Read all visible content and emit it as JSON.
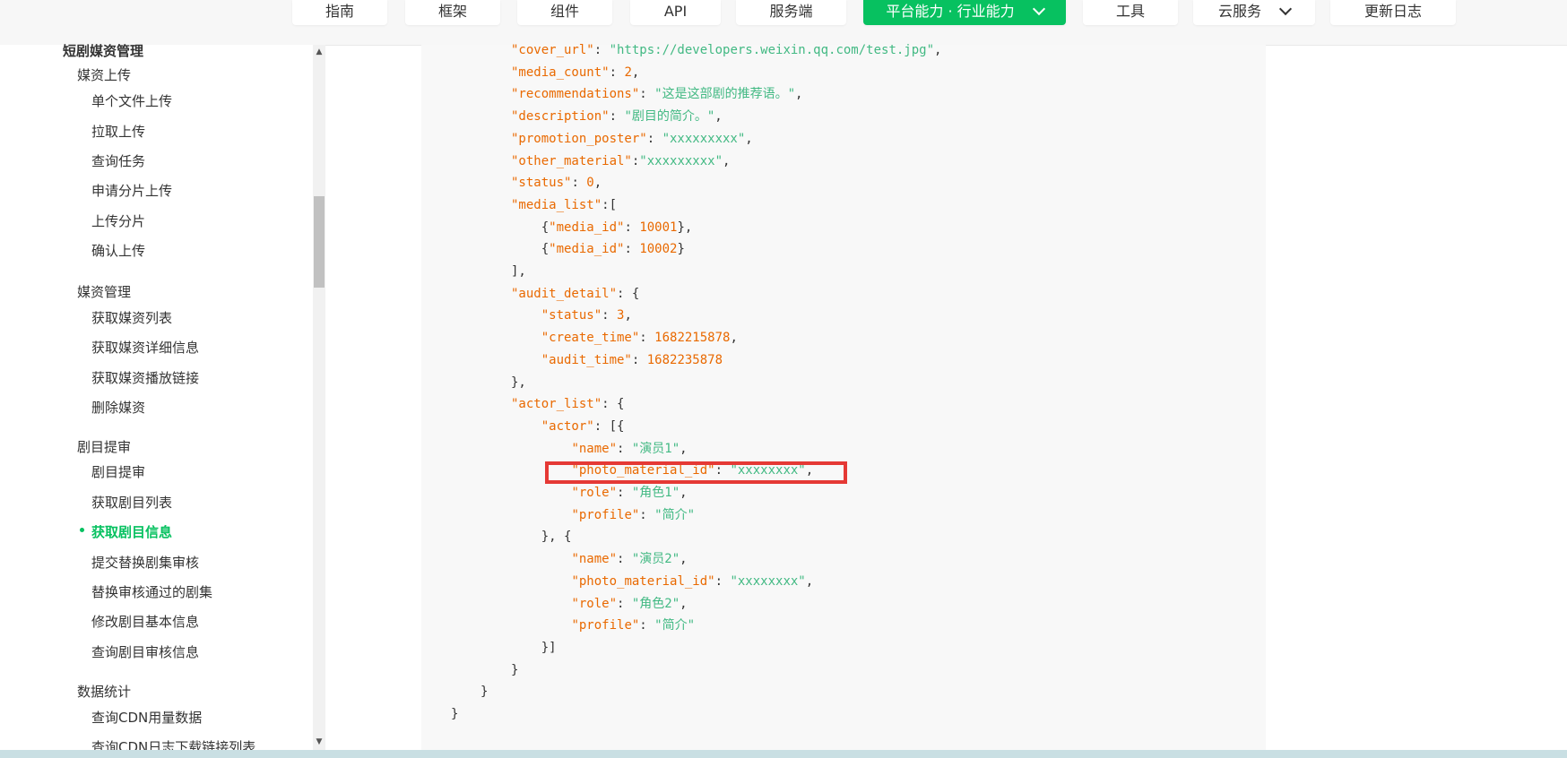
{
  "topnav": {
    "items": [
      {
        "label": "指南",
        "active": false
      },
      {
        "label": "框架",
        "active": false
      },
      {
        "label": "组件",
        "active": false
      },
      {
        "label": "API",
        "active": false
      },
      {
        "label": "服务端",
        "active": false
      },
      {
        "label": "平台能力 · 行业能力",
        "active": true,
        "dropdown": true
      },
      {
        "label": "工具",
        "active": false
      },
      {
        "label": "云服务",
        "active": false,
        "dropdown": true
      },
      {
        "label": "更新日志",
        "active": false
      }
    ],
    "accent_color": "#07c160"
  },
  "sidebar": {
    "top_section": "短剧媒资管理",
    "sections": [
      {
        "title": "媒资上传",
        "items": [
          "单个文件上传",
          "拉取上传",
          "查询任务",
          "申请分片上传",
          "上传分片",
          "确认上传"
        ]
      },
      {
        "title": "媒资管理",
        "items": [
          "获取媒资列表",
          "获取媒资详细信息",
          "获取媒资播放链接",
          "删除媒资"
        ]
      },
      {
        "title": "剧目提审",
        "items": [
          "剧目提审",
          "获取剧目列表",
          "获取剧目信息",
          "提交替换剧集审核",
          "替换审核通过的剧集",
          "修改剧目基本信息",
          "查询剧目审核信息"
        ],
        "active_item": "获取剧目信息"
      },
      {
        "title": "数据统计",
        "items": [
          "查询CDN用量数据",
          "查询CDN日志下载链接列表"
        ]
      }
    ]
  },
  "code": {
    "lines": [
      [
        {
          "t": "\"cover_url\"",
          "c": "k"
        },
        {
          "t": ": ",
          "c": "p"
        },
        {
          "t": "\"https://developers.weixin.qq.com/test.jpg\"",
          "c": "s"
        },
        {
          "t": ",",
          "c": "p"
        }
      ],
      [
        {
          "t": "\"media_count\"",
          "c": "k"
        },
        {
          "t": ": ",
          "c": "p"
        },
        {
          "t": "2",
          "c": "n"
        },
        {
          "t": ",",
          "c": "p"
        }
      ],
      [
        {
          "t": "\"recommendations\"",
          "c": "k"
        },
        {
          "t": ": ",
          "c": "p"
        },
        {
          "t": "\"这是这部剧的推荐语。\"",
          "c": "s"
        },
        {
          "t": ",",
          "c": "p"
        }
      ],
      [
        {
          "t": "\"description\"",
          "c": "k"
        },
        {
          "t": ": ",
          "c": "p"
        },
        {
          "t": "\"剧目的简介。\"",
          "c": "s"
        },
        {
          "t": ",",
          "c": "p"
        }
      ],
      [
        {
          "t": "\"promotion_poster\"",
          "c": "k"
        },
        {
          "t": ": ",
          "c": "p"
        },
        {
          "t": "\"xxxxxxxxx\"",
          "c": "s"
        },
        {
          "t": ",",
          "c": "p"
        }
      ],
      [
        {
          "t": "\"other_material\"",
          "c": "k"
        },
        {
          "t": ":",
          "c": "p"
        },
        {
          "t": "\"xxxxxxxxx\"",
          "c": "s"
        },
        {
          "t": ",",
          "c": "p"
        }
      ],
      [
        {
          "t": "\"status\"",
          "c": "k"
        },
        {
          "t": ": ",
          "c": "p"
        },
        {
          "t": "0",
          "c": "n"
        },
        {
          "t": ",",
          "c": "p"
        }
      ],
      [
        {
          "t": "\"media_list\"",
          "c": "k"
        },
        {
          "t": ":[",
          "c": "p"
        }
      ],
      [
        {
          "t": "    {",
          "c": "p"
        },
        {
          "t": "\"media_id\"",
          "c": "k"
        },
        {
          "t": ": ",
          "c": "p"
        },
        {
          "t": "10001",
          "c": "n"
        },
        {
          "t": "},",
          "c": "p"
        }
      ],
      [
        {
          "t": "    {",
          "c": "p"
        },
        {
          "t": "\"media_id\"",
          "c": "k"
        },
        {
          "t": ": ",
          "c": "p"
        },
        {
          "t": "10002",
          "c": "n"
        },
        {
          "t": "}",
          "c": "p"
        }
      ],
      [
        {
          "t": "],",
          "c": "p"
        }
      ],
      [
        {
          "t": "\"audit_detail\"",
          "c": "k"
        },
        {
          "t": ": {",
          "c": "p"
        }
      ],
      [
        {
          "t": "    ",
          "c": "p"
        },
        {
          "t": "\"status\"",
          "c": "k"
        },
        {
          "t": ": ",
          "c": "p"
        },
        {
          "t": "3",
          "c": "n"
        },
        {
          "t": ",",
          "c": "p"
        }
      ],
      [
        {
          "t": "    ",
          "c": "p"
        },
        {
          "t": "\"create_time\"",
          "c": "k"
        },
        {
          "t": ": ",
          "c": "p"
        },
        {
          "t": "1682215878",
          "c": "n"
        },
        {
          "t": ",",
          "c": "p"
        }
      ],
      [
        {
          "t": "    ",
          "c": "p"
        },
        {
          "t": "\"audit_time\"",
          "c": "k"
        },
        {
          "t": ": ",
          "c": "p"
        },
        {
          "t": "1682235878",
          "c": "n"
        }
      ],
      [
        {
          "t": "},",
          "c": "p"
        }
      ],
      [
        {
          "t": "\"actor_list\"",
          "c": "k"
        },
        {
          "t": ": {",
          "c": "p"
        }
      ],
      [
        {
          "t": "    ",
          "c": "p"
        },
        {
          "t": "\"actor\"",
          "c": "k"
        },
        {
          "t": ": [{",
          "c": "p"
        }
      ],
      [
        {
          "t": "        ",
          "c": "p"
        },
        {
          "t": "\"name\"",
          "c": "k"
        },
        {
          "t": ": ",
          "c": "p"
        },
        {
          "t": "\"演员1\"",
          "c": "s"
        },
        {
          "t": ",",
          "c": "p"
        }
      ],
      [
        {
          "t": "        ",
          "c": "p"
        },
        {
          "t": "\"photo_material_id\"",
          "c": "k"
        },
        {
          "t": ": ",
          "c": "p"
        },
        {
          "t": "\"xxxxxxxx\"",
          "c": "s"
        },
        {
          "t": ",",
          "c": "p"
        }
      ],
      [
        {
          "t": "        ",
          "c": "p"
        },
        {
          "t": "\"role\"",
          "c": "k"
        },
        {
          "t": ": ",
          "c": "p"
        },
        {
          "t": "\"角色1\"",
          "c": "s"
        },
        {
          "t": ",",
          "c": "p"
        }
      ],
      [
        {
          "t": "        ",
          "c": "p"
        },
        {
          "t": "\"profile\"",
          "c": "k"
        },
        {
          "t": ": ",
          "c": "p"
        },
        {
          "t": "\"简介\"",
          "c": "s"
        }
      ],
      [
        {
          "t": "    }, {",
          "c": "p"
        }
      ],
      [
        {
          "t": "        ",
          "c": "p"
        },
        {
          "t": "\"name\"",
          "c": "k"
        },
        {
          "t": ": ",
          "c": "p"
        },
        {
          "t": "\"演员2\"",
          "c": "s"
        },
        {
          "t": ",",
          "c": "p"
        }
      ],
      [
        {
          "t": "        ",
          "c": "p"
        },
        {
          "t": "\"photo_material_id\"",
          "c": "k"
        },
        {
          "t": ": ",
          "c": "p"
        },
        {
          "t": "\"xxxxxxxx\"",
          "c": "s"
        },
        {
          "t": ",",
          "c": "p"
        }
      ],
      [
        {
          "t": "        ",
          "c": "p"
        },
        {
          "t": "\"role\"",
          "c": "k"
        },
        {
          "t": ": ",
          "c": "p"
        },
        {
          "t": "\"角色2\"",
          "c": "s"
        },
        {
          "t": ",",
          "c": "p"
        }
      ],
      [
        {
          "t": "        ",
          "c": "p"
        },
        {
          "t": "\"profile\"",
          "c": "k"
        },
        {
          "t": ": ",
          "c": "p"
        },
        {
          "t": "\"简介\"",
          "c": "s"
        }
      ],
      [
        {
          "t": "    }]",
          "c": "p"
        }
      ],
      [
        {
          "t": "}",
          "c": "p"
        }
      ],
      [
        {
          "t": "}",
          "c": "p"
        }
      ],
      [
        {
          "t": "}",
          "c": "p"
        }
      ]
    ],
    "highlight_color": "#e53935"
  }
}
